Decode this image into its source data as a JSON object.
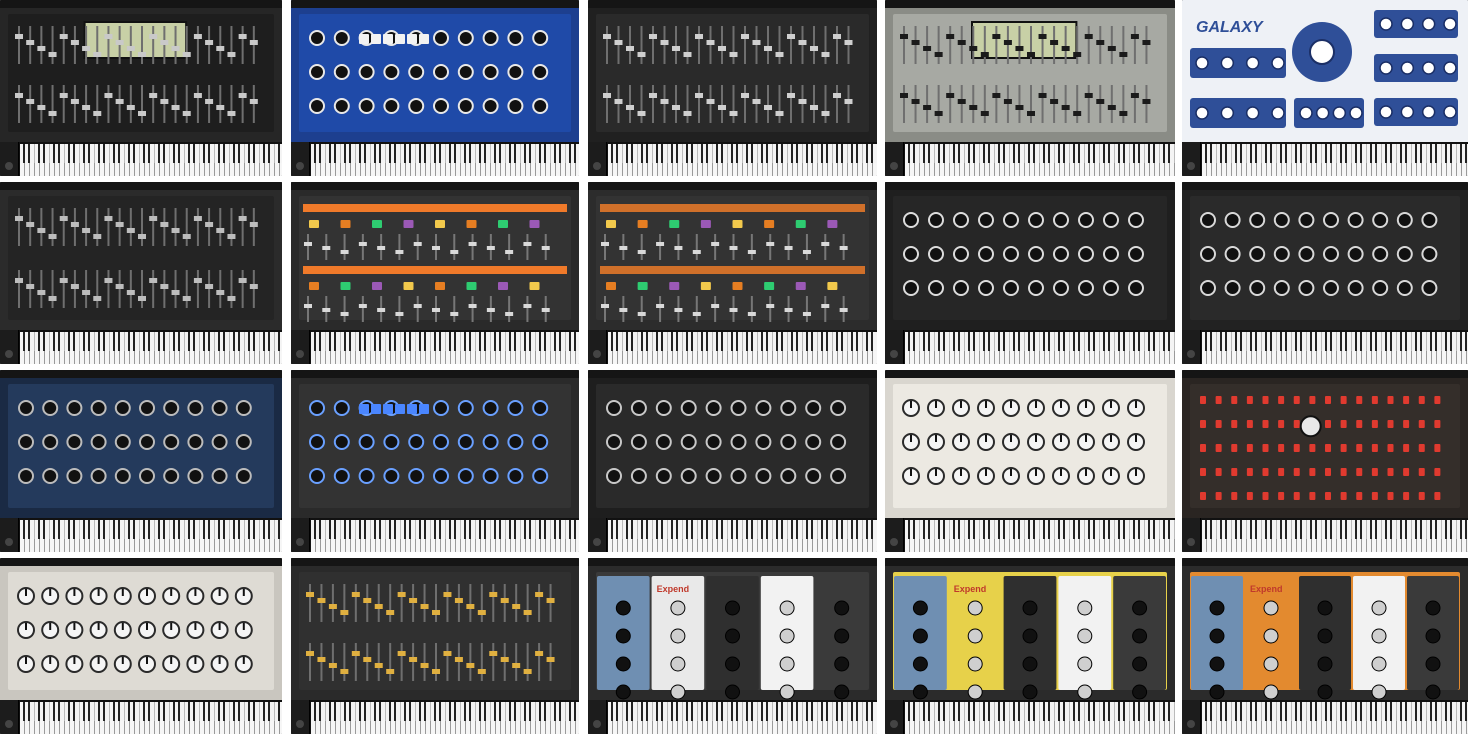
{
  "tiles": [
    {
      "row": 0,
      "col": 0,
      "brand": "",
      "bg": "#262626",
      "panel": "#1e1e1e",
      "accent": "#c9c9c9",
      "style": "sliders",
      "lcd": true
    },
    {
      "row": 0,
      "col": 1,
      "brand": "",
      "bg": "#1d3f8f",
      "panel": "#1f4aa8",
      "accent": "#e8e8e8",
      "style": "knobs-buttons"
    },
    {
      "row": 0,
      "col": 2,
      "brand": "",
      "bg": "#202020",
      "panel": "#2a2a2a",
      "accent": "#cfcfcf",
      "style": "sliders"
    },
    {
      "row": 0,
      "col": 3,
      "brand": "",
      "bg": "#8a8c86",
      "panel": "#a7a9a3",
      "accent": "#1b1b1b",
      "style": "sliders",
      "lcd": true
    },
    {
      "row": 0,
      "col": 4,
      "brand": "GALAXY",
      "bg": "#e9ecf2",
      "panel": "#2f4f98",
      "accent": "#ffffff",
      "style": "galaxy"
    },
    {
      "row": 1,
      "col": 0,
      "brand": "",
      "bg": "#2b2b2b",
      "panel": "#242424",
      "accent": "#bdbdbd",
      "style": "sliders"
    },
    {
      "row": 1,
      "col": 1,
      "brand": "",
      "bg": "#2a2a2a",
      "panel": "#333",
      "accent": "#f07a2a",
      "style": "orange-bands"
    },
    {
      "row": 1,
      "col": 2,
      "brand": "",
      "bg": "#2c2c2c",
      "panel": "#333",
      "accent": "#d0702a",
      "style": "orange-bands"
    },
    {
      "row": 1,
      "col": 3,
      "brand": "",
      "bg": "#1f1f1f",
      "panel": "#262626",
      "accent": "#dcdcdc",
      "style": "knobs"
    },
    {
      "row": 1,
      "col": 4,
      "brand": "",
      "bg": "#222",
      "panel": "#2a2a2a",
      "accent": "#d8d8d8",
      "style": "knobs"
    },
    {
      "row": 2,
      "col": 0,
      "brand": "",
      "bg": "#1a2a44",
      "panel": "#243a5c",
      "accent": "#bcbcbc",
      "style": "knobs"
    },
    {
      "row": 2,
      "col": 1,
      "brand": "",
      "bg": "#2a2a2a",
      "panel": "#333",
      "accent": "#6aa0ff",
      "style": "mixed"
    },
    {
      "row": 2,
      "col": 2,
      "brand": "",
      "bg": "#1e1e1e",
      "panel": "#2a2a2a",
      "accent": "#c8c8c8",
      "style": "knobs"
    },
    {
      "row": 2,
      "col": 3,
      "brand": "",
      "bg": "#d9d6cf",
      "panel": "#ece9e2",
      "accent": "#111",
      "style": "light-knobs"
    },
    {
      "row": 2,
      "col": 4,
      "brand": "",
      "bg": "#2a2522",
      "panel": "#342e2a",
      "accent": "#e03a2f",
      "style": "red-switches"
    },
    {
      "row": 3,
      "col": 0,
      "brand": "",
      "bg": "#c9c6bf",
      "panel": "#dedbd4",
      "accent": "#222",
      "style": "light-knobs"
    },
    {
      "row": 3,
      "col": 1,
      "brand": "",
      "bg": "#2a2a2a",
      "panel": "#303030",
      "accent": "#e0b040",
      "style": "sliders"
    },
    {
      "row": 3,
      "col": 2,
      "brand": "Expend",
      "bg": "#2b2b2b",
      "panel": "#3a3a3a",
      "accent": "#cfcfcf",
      "style": "modular"
    },
    {
      "row": 3,
      "col": 3,
      "brand": "Expend",
      "bg": "#2b2b2b",
      "panel": "#e7d14a",
      "accent": "#111",
      "style": "modular-yellow"
    },
    {
      "row": 3,
      "col": 4,
      "brand": "Expend",
      "bg": "#2b2b2b",
      "panel": "#e38a2f",
      "accent": "#111",
      "style": "modular-orange"
    }
  ]
}
